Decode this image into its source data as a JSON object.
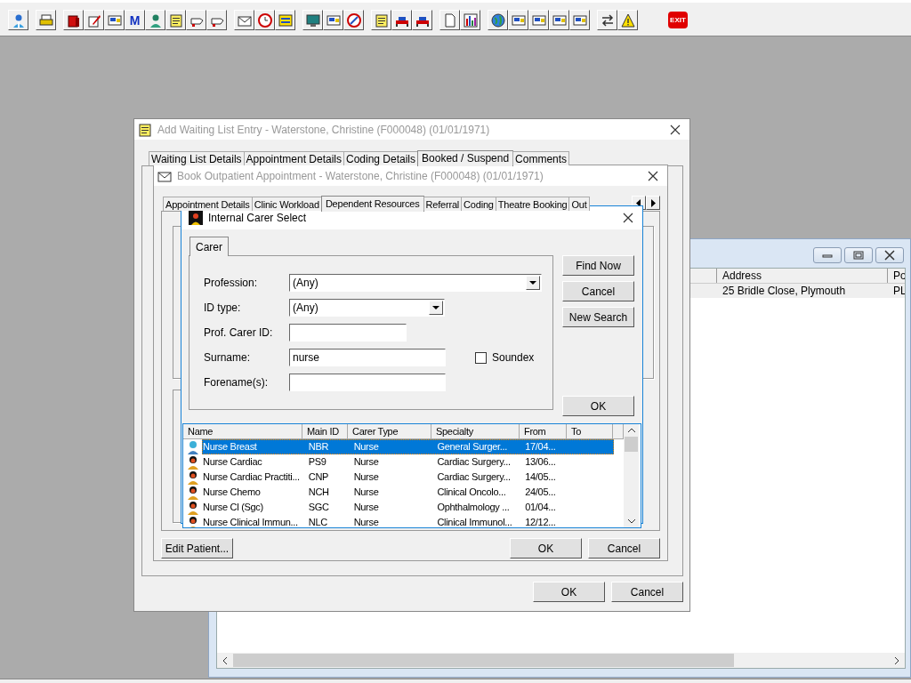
{
  "toolbar": {
    "mail_label": "M",
    "exit_label": "EXIT"
  },
  "patient_window": {
    "columns": [
      {
        "label": "Address"
      },
      {
        "label": "Po"
      }
    ],
    "rows": [
      {
        "cells": [
          "25 Bridle Close, Plymouth",
          "PL"
        ],
        "selected": true
      }
    ]
  },
  "waiting_window": {
    "title": "Add Waiting List Entry - Waterstone, Christine (F000048) (01/01/1971)",
    "tabs": [
      {
        "label": "Waiting List Details",
        "selected": false
      },
      {
        "label": "Appointment Details",
        "selected": false
      },
      {
        "label": "Coding Details",
        "selected": false
      },
      {
        "label": "Booked / Suspend",
        "selected": true
      },
      {
        "label": "Comments",
        "selected": false
      }
    ],
    "buttons": [
      "OK",
      "Cancel"
    ]
  },
  "booking_window": {
    "title": "Book Outpatient Appointment - Waterstone, Christine (F000048) (01/01/1971)",
    "tabs": [
      {
        "label": "Appointment Details",
        "selected": false
      },
      {
        "label": "Clinic Workload",
        "selected": false
      },
      {
        "label": "Dependent Resources",
        "selected": true
      },
      {
        "label": "Referral",
        "selected": false
      },
      {
        "label": "Coding",
        "selected": false
      },
      {
        "label": "Theatre Booking",
        "selected": false
      },
      {
        "label": "Out",
        "selected": false
      }
    ],
    "edit_button": "Edit Patient...",
    "buttons": [
      "OK",
      "Cancel"
    ]
  },
  "carer_dialog": {
    "title": "Internal Carer Select",
    "tabs": [
      {
        "label": "Carer",
        "selected": true
      }
    ],
    "fields": [
      {
        "kind": "select",
        "label": "Profession:",
        "value": "(Any)"
      },
      {
        "kind": "select",
        "label": "ID type:",
        "value": "(Any)"
      },
      {
        "kind": "text",
        "label": "Prof. Carer ID:"
      },
      {
        "kind": "text",
        "label": "Surname:",
        "value": "nurse"
      },
      {
        "kind": "text",
        "label": "Forename(s):"
      }
    ],
    "soundex": {
      "label": "Soundex",
      "checked": false
    },
    "buttons": [
      "Find Now",
      "Cancel",
      "New Search"
    ],
    "ok_button": "OK",
    "list": {
      "columns": [
        "Name",
        "Main ID",
        "Carer Type",
        "Specialty",
        "From",
        "To"
      ],
      "rows": [
        {
          "cells": [
            "Nurse Breast",
            "NBR",
            "Nurse",
            "General Surger...",
            "17/04..."
          ],
          "selected": true
        },
        {
          "cells": [
            "Nurse Cardiac",
            "PS9",
            "Nurse",
            "Cardiac Surgery...",
            "13/06..."
          ],
          "selected": false
        },
        {
          "cells": [
            "Nurse Cardiac Practiti...",
            "CNP",
            "Nurse",
            "Cardiac Surgery...",
            "14/05..."
          ],
          "selected": false
        },
        {
          "cells": [
            "Nurse Chemo",
            "NCH",
            "Nurse",
            "Clinical Oncolo...",
            "24/05..."
          ],
          "selected": false
        },
        {
          "cells": [
            "Nurse Cl (Sgc)",
            "SGC",
            "Nurse",
            "Ophthalmology ...",
            "01/04..."
          ],
          "selected": false
        },
        {
          "cells": [
            "Nurse Clinical Immun...",
            "NLC",
            "Nurse",
            "Clinical Immunol...",
            "12/12..."
          ],
          "selected": false
        }
      ]
    }
  }
}
